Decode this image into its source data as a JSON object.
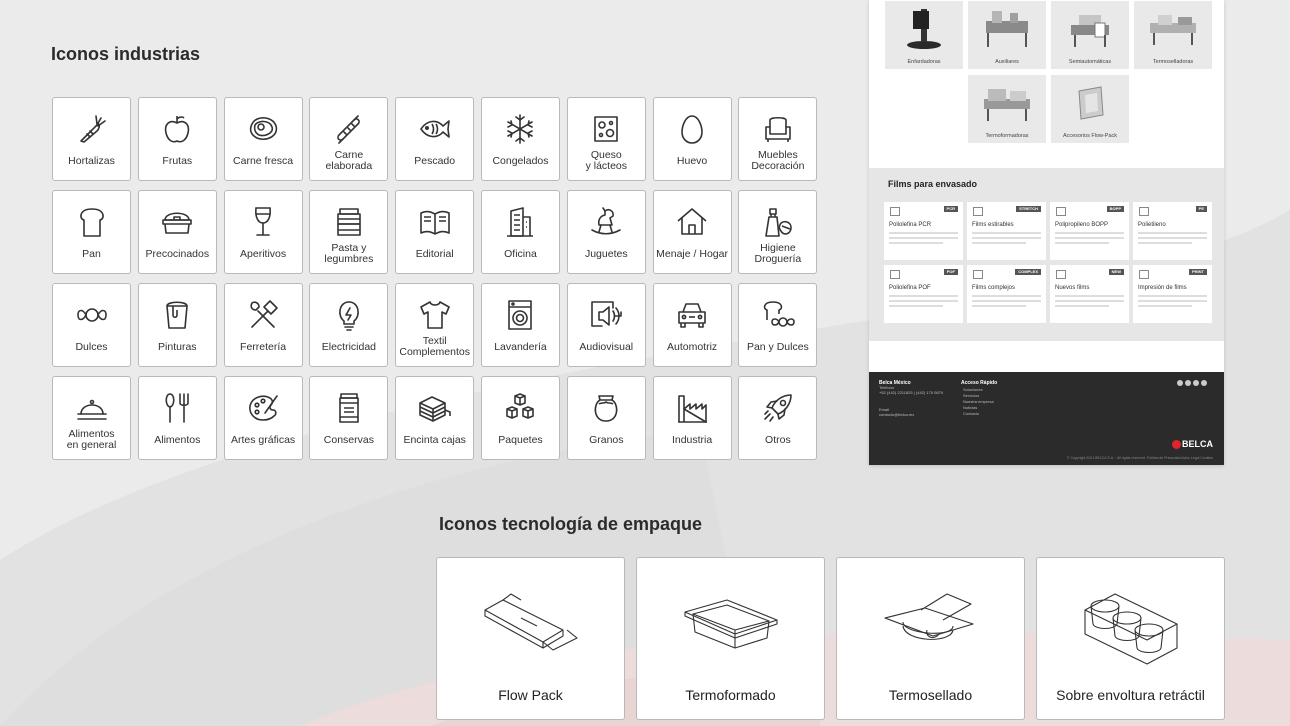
{
  "sections": {
    "industries_title": "Iconos industrias",
    "tech_title": "Iconos tecnología de empaque"
  },
  "industries": [
    {
      "label": "Hortalizas",
      "icon": "carrot-icon"
    },
    {
      "label": "Frutas",
      "icon": "apple-icon"
    },
    {
      "label": "Carne fresca",
      "icon": "steak-icon"
    },
    {
      "label": "Carne\nelaborada",
      "icon": "sausage-icon"
    },
    {
      "label": "Pescado",
      "icon": "fish-icon"
    },
    {
      "label": "Congelados",
      "icon": "snowflake-icon"
    },
    {
      "label": "Queso\ny lácteos",
      "icon": "cheese-icon"
    },
    {
      "label": "Huevo",
      "icon": "egg-icon"
    },
    {
      "label": "Muebles\nDecoración",
      "icon": "armchair-icon"
    },
    {
      "label": "Pan",
      "icon": "bread-icon"
    },
    {
      "label": "Precocinados",
      "icon": "food-container-icon"
    },
    {
      "label": "Aperitivos",
      "icon": "wine-glass-icon"
    },
    {
      "label": "Pasta y\nlegumbres",
      "icon": "jar-stack-icon"
    },
    {
      "label": "Editorial",
      "icon": "book-icon"
    },
    {
      "label": "Oficina",
      "icon": "building-icon"
    },
    {
      "label": "Juguetes",
      "icon": "rocking-horse-icon"
    },
    {
      "label": "Menaje / Hogar",
      "icon": "house-icon"
    },
    {
      "label": "Higiene\nDroguería",
      "icon": "spray-bottle-icon"
    },
    {
      "label": "Dulces",
      "icon": "candy-icon"
    },
    {
      "label": "Pinturas",
      "icon": "paint-bucket-icon"
    },
    {
      "label": "Ferretería",
      "icon": "tools-icon"
    },
    {
      "label": "Electricidad",
      "icon": "lightbulb-icon"
    },
    {
      "label": "Textil\nComplementos",
      "icon": "tshirt-icon"
    },
    {
      "label": "Lavandería",
      "icon": "washing-machine-icon"
    },
    {
      "label": "Audiovisual",
      "icon": "speaker-icon"
    },
    {
      "label": "Automotriz",
      "icon": "car-icon"
    },
    {
      "label": "Pan y Dulces",
      "icon": "bread-candy-icon"
    },
    {
      "label": "Alimentos\nen general",
      "icon": "cloche-icon"
    },
    {
      "label": "Alimentos",
      "icon": "cutlery-icon"
    },
    {
      "label": "Artes gráficas",
      "icon": "palette-icon"
    },
    {
      "label": "Conservas",
      "icon": "can-icon"
    },
    {
      "label": "Encinta cajas",
      "icon": "tape-box-icon"
    },
    {
      "label": "Paquetes",
      "icon": "boxes-icon"
    },
    {
      "label": "Granos",
      "icon": "grain-sack-icon"
    },
    {
      "label": "Industria",
      "icon": "factory-icon"
    },
    {
      "label": "Otros",
      "icon": "rocket-icon"
    }
  ],
  "site_preview": {
    "products": [
      {
        "label": "Enfardadoras"
      },
      {
        "label": "Auxiliares"
      },
      {
        "label": "Semiautomáticas"
      },
      {
        "label": "Termoselladoras"
      },
      {
        "label": "Termoformadoras"
      },
      {
        "label": "Accesorios Flow-Pack"
      }
    ],
    "films_title": "Films para envasado",
    "films": [
      {
        "badge": "PCR",
        "title": "Poliolefina PCR"
      },
      {
        "badge": "STRETCH",
        "title": "Films estirables"
      },
      {
        "badge": "BOPP",
        "title": "Polipropileno BOPP"
      },
      {
        "badge": "PE",
        "title": "Polietileno"
      },
      {
        "badge": "POF",
        "title": "Poliolefina POF"
      },
      {
        "badge": "COMPLEX",
        "title": "Films complejos"
      },
      {
        "badge": "NEW",
        "title": "Nuevos films"
      },
      {
        "badge": "PRINT",
        "title": "Impresión de films"
      }
    ],
    "footer": {
      "company": "Belca México",
      "phone_label": "Teléfono",
      "phone": "+52 (442) 2211825  |  (442) 175 0879",
      "email_label": "Email",
      "email": "contacto@belca.mx",
      "quick_title": "Acceso Rápido",
      "links": [
        "Soluciones",
        "Servicios",
        "Nuestra empresa",
        "Noticias",
        "Contacto"
      ],
      "brand": "BELCA",
      "copyright": "© Copyright 2021 BELCA S.A. · All rights reserved. Política de Privacidad  Aviso Legal  Cookies"
    }
  },
  "packaging": [
    {
      "label": "Flow Pack",
      "icon": "flow-pack-icon"
    },
    {
      "label": "Termoformado",
      "icon": "thermoform-tray-icon"
    },
    {
      "label": "Termosellado",
      "icon": "thermoseal-tray-icon"
    },
    {
      "label": "Sobre envoltura retráctil",
      "icon": "shrink-wrap-icon"
    }
  ]
}
